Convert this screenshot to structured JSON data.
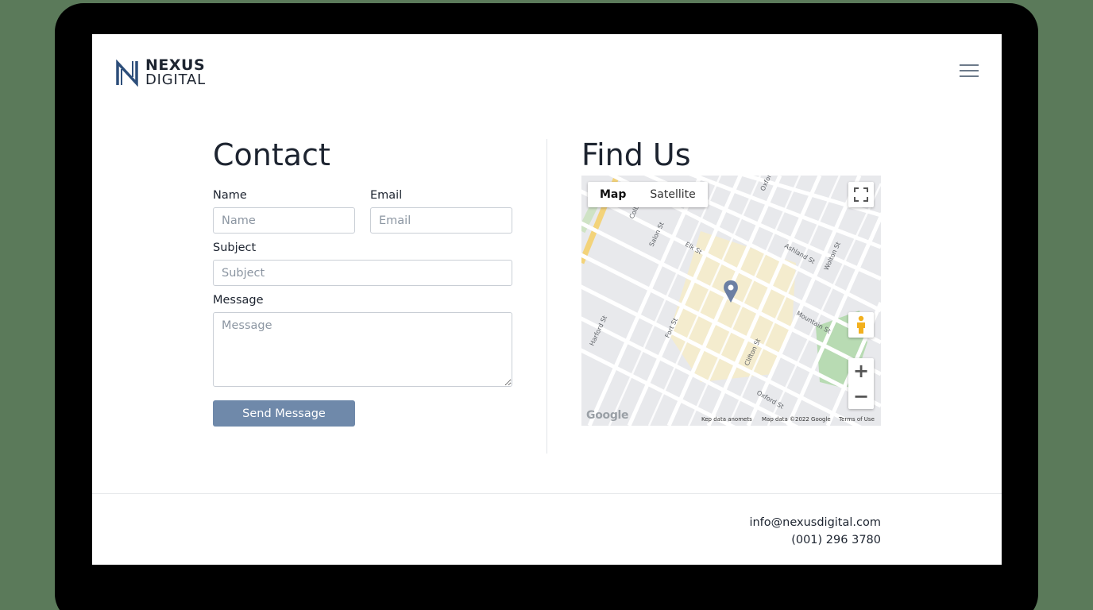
{
  "brand": {
    "line1": "NEXUS",
    "line2": "DIGITAL"
  },
  "contact": {
    "title": "Contact",
    "name_label": "Name",
    "name_placeholder": "Name",
    "email_label": "Email",
    "email_placeholder": "Email",
    "subject_label": "Subject",
    "subject_placeholder": "Subject",
    "message_label": "Message",
    "message_placeholder": "Message",
    "send_label": "Send Message"
  },
  "find": {
    "title": "Find Us",
    "map_type_map": "Map",
    "map_type_satellite": "Satellite",
    "zoom_in": "+",
    "zoom_out": "−",
    "google": "Google",
    "footer_shortcuts": "Kep data anomets",
    "footer_mapdata": "Map data ©2022 Google",
    "footer_terms": "Terms of Use",
    "streets": [
      "Oxford St",
      "Colby St",
      "Salon St",
      "Elk St",
      "Ashland St",
      "Wolton St",
      "Mountain St",
      "Harford St",
      "Fort St",
      "Clifton St"
    ]
  },
  "footer": {
    "email": "info@nexusdigital.com",
    "phone": "(001) 296 3780"
  },
  "colors": {
    "accent_button": "#6f89aa",
    "map_pin": "#6b7fa3",
    "text_dark": "#1d2430"
  }
}
